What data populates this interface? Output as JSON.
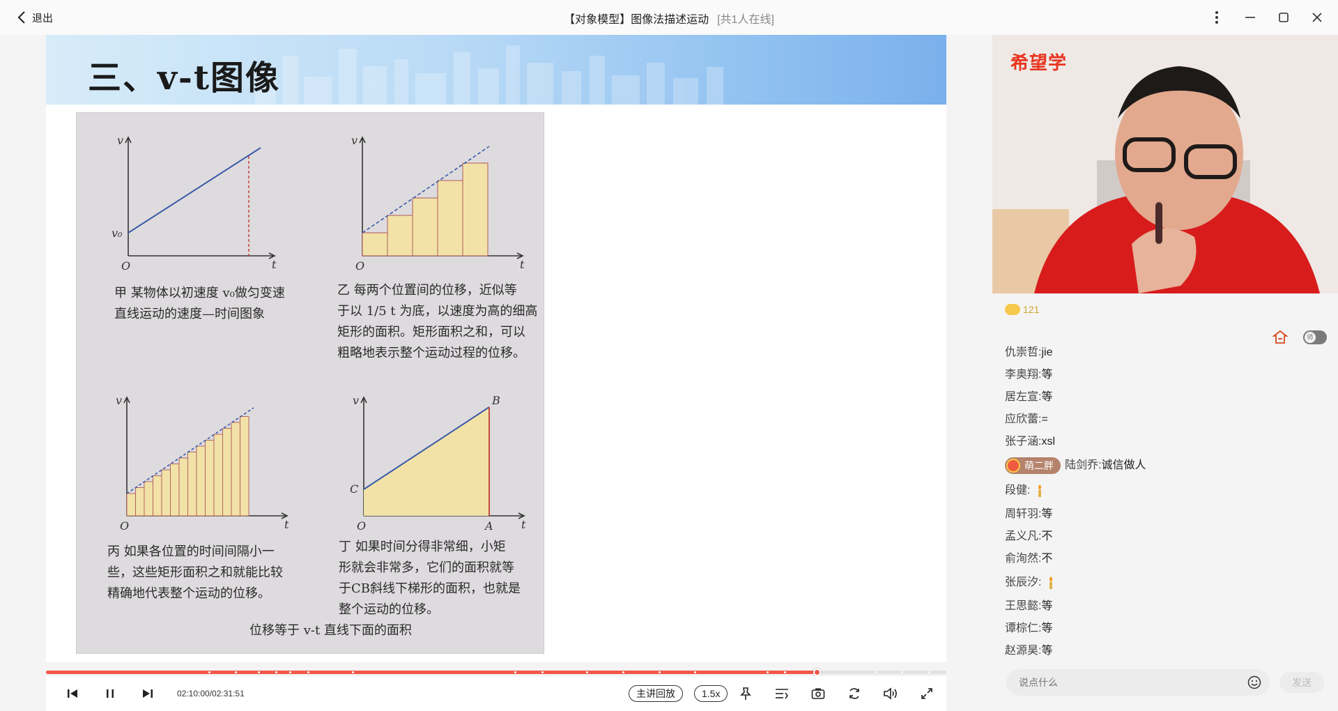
{
  "titlebar": {
    "back_label": "退出",
    "title": "【对象模型】图像法描述运动",
    "online": "[共1人在线]"
  },
  "slide": {
    "title": "三、v-t图像",
    "figure": {
      "axis_v": "v",
      "axis_t": "t",
      "origin": "O",
      "v0": "v₀",
      "label_B": "B",
      "label_C": "C",
      "label_A": "A",
      "caption_jia": [
        "甲  某物体以初速度 v₀做匀变速",
        "直线运动的速度—时间图象"
      ],
      "caption_yi": [
        "乙  每两个位置间的位移，近似等",
        "于以 1/5 t 为底，以速度为高的细高",
        "矩形的面积。矩形面积之和，可以",
        "粗略地表示整个运动过程的位移。"
      ],
      "caption_bing": [
        "丙  如果各位置的时间间隔小一",
        "些，这些矩形面积之和就能比较",
        "精确地代表整个运动的位移。"
      ],
      "caption_ding": [
        "丁  如果时间分得非常细，小矩",
        "形就会非常多，它们的面积就等",
        "于CB斜线下梯形的面积，也就是",
        "整个运动的位移。"
      ],
      "bottom_caption": "位移等于 v-t 直线下面的面积"
    }
  },
  "player": {
    "time": "02:10:00/02:31:51",
    "progress_fraction": 0.857,
    "replay_label": "主讲回放",
    "speed_label": "1.5x"
  },
  "side": {
    "logo": "希望学",
    "coins": "121",
    "teacher_toggle_label": "师",
    "chat": [
      {
        "name": "仇崇哲",
        "text": "jie"
      },
      {
        "name": "李奥翔",
        "text": "等"
      },
      {
        "name": "居左宣",
        "text": "等"
      },
      {
        "name": "应欣蕾",
        "text": "="
      },
      {
        "name": "张子涵",
        "text": "xsl"
      },
      {
        "badge": "萌二胖",
        "name": "陆剑乔",
        "text": "诚信做人"
      },
      {
        "name": "段健",
        "text": ""
      },
      {
        "name": "周轩羽",
        "text": "等"
      },
      {
        "name": "孟义凡",
        "text": "不"
      },
      {
        "name": "俞洵然",
        "text": "不"
      },
      {
        "name": "张辰汐",
        "text": ""
      },
      {
        "name": "王思懿",
        "text": "等"
      },
      {
        "name": "谭棕仁",
        "text": "等"
      },
      {
        "name": "赵源昊",
        "text": "等"
      }
    ],
    "input_placeholder": "说点什么",
    "send_label": "发送"
  }
}
